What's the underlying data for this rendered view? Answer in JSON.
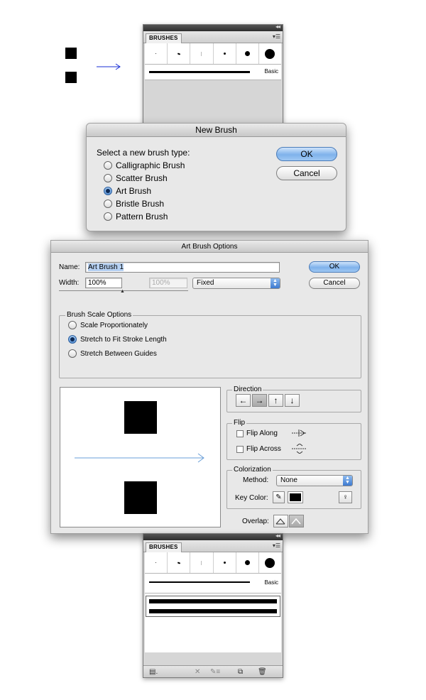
{
  "brushes_panel": {
    "tab_label": "BRUSHES",
    "menu_icon": "panel-menu-icon",
    "basic_label": "Basic"
  },
  "new_brush_dialog": {
    "title": "New Brush",
    "prompt": "Select a new brush type:",
    "options": [
      "Calligraphic Brush",
      "Scatter Brush",
      "Art Brush",
      "Bristle Brush",
      "Pattern Brush"
    ],
    "selected": "Art Brush",
    "ok_label": "OK",
    "cancel_label": "Cancel"
  },
  "art_brush_options": {
    "title": "Art Brush Options",
    "name_label": "Name:",
    "name_value": "Art Brush 1",
    "width_label": "Width:",
    "width_value": "100%",
    "width_disabled_value": "100%",
    "width_mode": "Fixed",
    "ok_label": "OK",
    "cancel_label": "Cancel",
    "scale_group_title": "Brush Scale Options",
    "scale_options": [
      "Scale Proportionately",
      "Stretch to Fit Stroke Length",
      "Stretch Between Guides"
    ],
    "scale_selected": "Stretch to Fit Stroke Length",
    "direction_title": "Direction",
    "direction_buttons": [
      "←",
      "→",
      "↑",
      "↓"
    ],
    "direction_selected": "→",
    "flip_title": "Flip",
    "flip_along_label": "Flip Along",
    "flip_across_label": "Flip Across",
    "colorization_title": "Colorization",
    "method_label": "Method:",
    "method_value": "None",
    "key_color_label": "Key Color:",
    "overlap_label": "Overlap:"
  },
  "bottom_panel": {
    "tab_label": "BRUSHES",
    "basic_label": "Basic"
  },
  "colors": {
    "accent_blue": "#3d7ad0",
    "arrow_blue": "#1a2fd6",
    "preview_arrow": "#6a9fd8"
  }
}
